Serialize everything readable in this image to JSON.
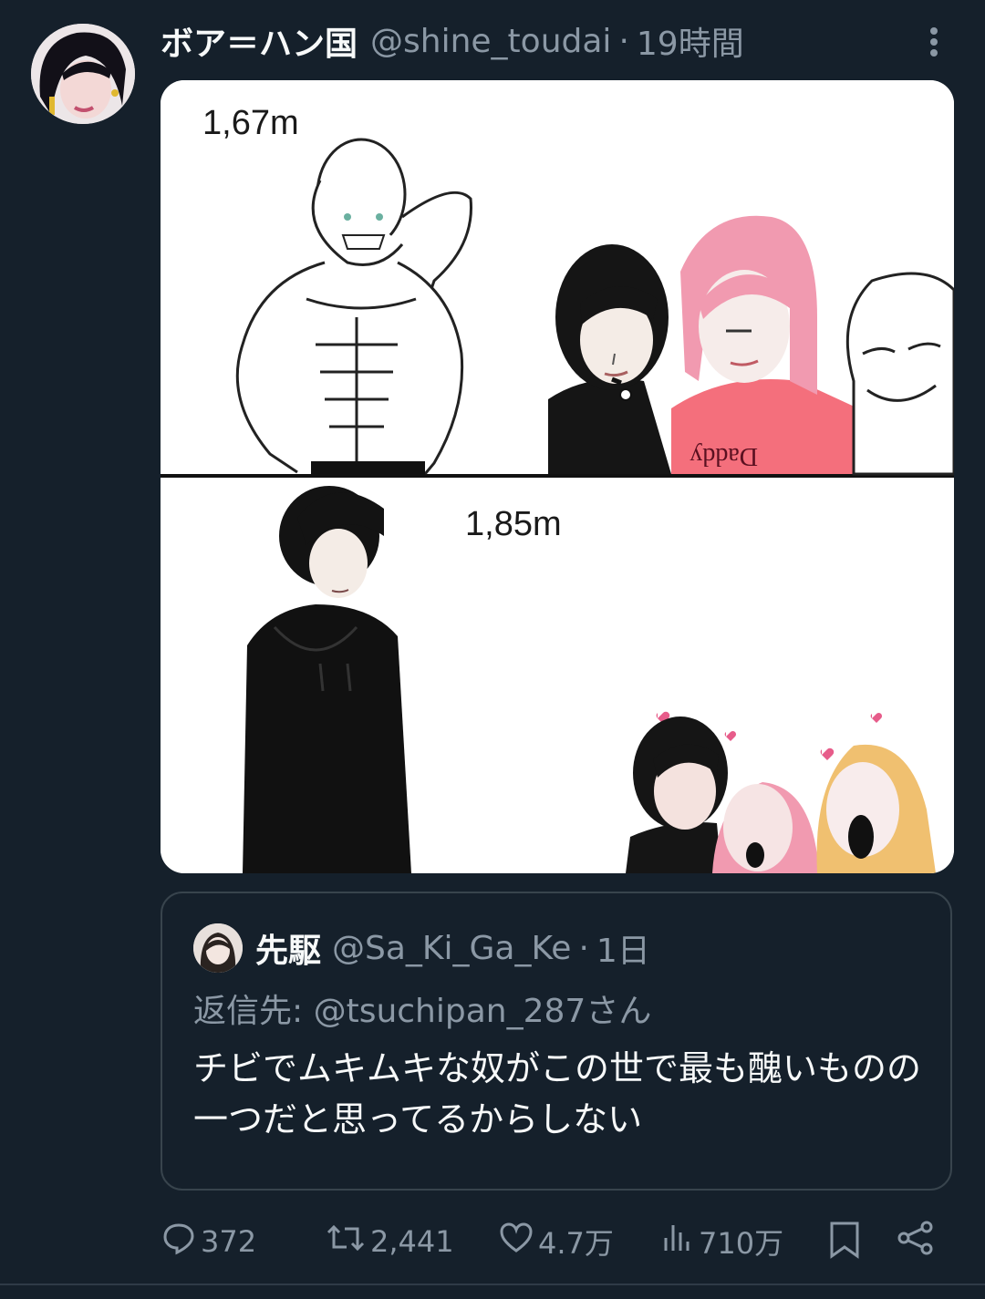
{
  "tweet": {
    "author_name": "ボア＝ハン国",
    "author_handle": "@shine_toudai",
    "separator": "·",
    "time": "19時間",
    "media": {
      "top_label": "1,67m",
      "bottom_label": "1,85m",
      "shirt_text": "Daddy"
    }
  },
  "quote": {
    "author_name": "先駆",
    "author_handle": "@Sa_Ki_Ga_Ke",
    "separator": "·",
    "time": "1日",
    "reply_to": "返信先: @tsuchipan_287さん",
    "text": "チビでムキムキな奴がこの世で最も醜いものの一つだと思ってるからしない"
  },
  "actions": {
    "replies": "372",
    "retweets": "2,441",
    "likes": "4.7万",
    "views": "710万"
  },
  "colors": {
    "background": "#15202b",
    "muted_text": "#8b98a5",
    "border": "#38444d"
  }
}
